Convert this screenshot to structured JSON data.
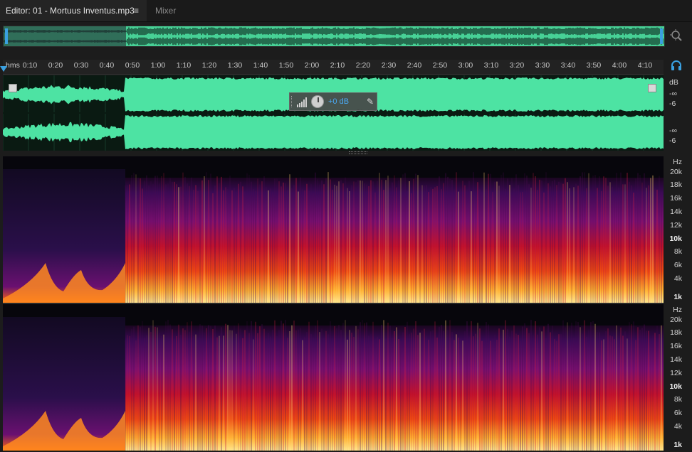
{
  "tabs": {
    "editor_label": "Editor: 01 - Mortuus Inventus.mp3",
    "menu_glyph": "≡",
    "mixer_label": "Mixer"
  },
  "ruler": {
    "unit": "hms",
    "labels": [
      "0:10",
      "0:20",
      "0:30",
      "0:40",
      "0:50",
      "1:00",
      "1:10",
      "1:20",
      "1:30",
      "1:40",
      "1:50",
      "2:00",
      "2:10",
      "2:20",
      "2:30",
      "2:40",
      "2:50",
      "3:00",
      "3:10",
      "3:20",
      "3:30",
      "3:40",
      "3:50",
      "4:00",
      "4:10"
    ]
  },
  "waveform": {
    "channel_top_db": [
      "dB",
      "-∞",
      "-6"
    ],
    "channel_bottom_db": [
      "-∞",
      "-6"
    ],
    "color": "#4de3a3"
  },
  "hud": {
    "gain_label": "+0 dB",
    "pin_glyph": "📌"
  },
  "spectral": {
    "top_labels": [
      "Hz",
      "20k",
      "18k",
      "16k",
      "14k",
      "12k",
      "10k",
      "8k",
      "6k",
      "4k",
      "1k"
    ],
    "bottom_labels": [
      "Hz",
      "20k",
      "18k",
      "16k",
      "14k",
      "12k",
      "10k",
      "8k",
      "6k",
      "4k",
      "1k"
    ]
  },
  "colors": {
    "accent": "#3aa0e0",
    "waveform": "#4de3a3",
    "gain_text": "#4aa8f0"
  }
}
